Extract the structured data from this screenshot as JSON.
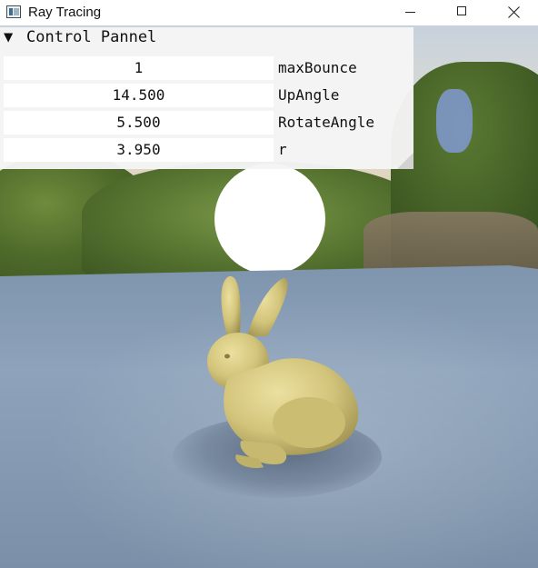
{
  "window": {
    "title": "Ray Tracing"
  },
  "panel": {
    "collapse_glyph": "▼",
    "title": "Control Pannel",
    "rows": [
      {
        "value": "1",
        "label": "maxBounce"
      },
      {
        "value": "14.500",
        "label": "UpAngle"
      },
      {
        "value": "5.500",
        "label": "RotateAngle"
      },
      {
        "value": "3.950",
        "label": "r"
      }
    ]
  },
  "colors": {
    "floor": "#8ea3bb",
    "bunny": "#d8cc82",
    "sun": "#ffffff",
    "panel_bg": "#f5f5f5"
  },
  "icons": {
    "app": "app-window-icon",
    "minimize": "minimize-icon",
    "maximize": "maximize-icon",
    "close": "close-icon"
  }
}
